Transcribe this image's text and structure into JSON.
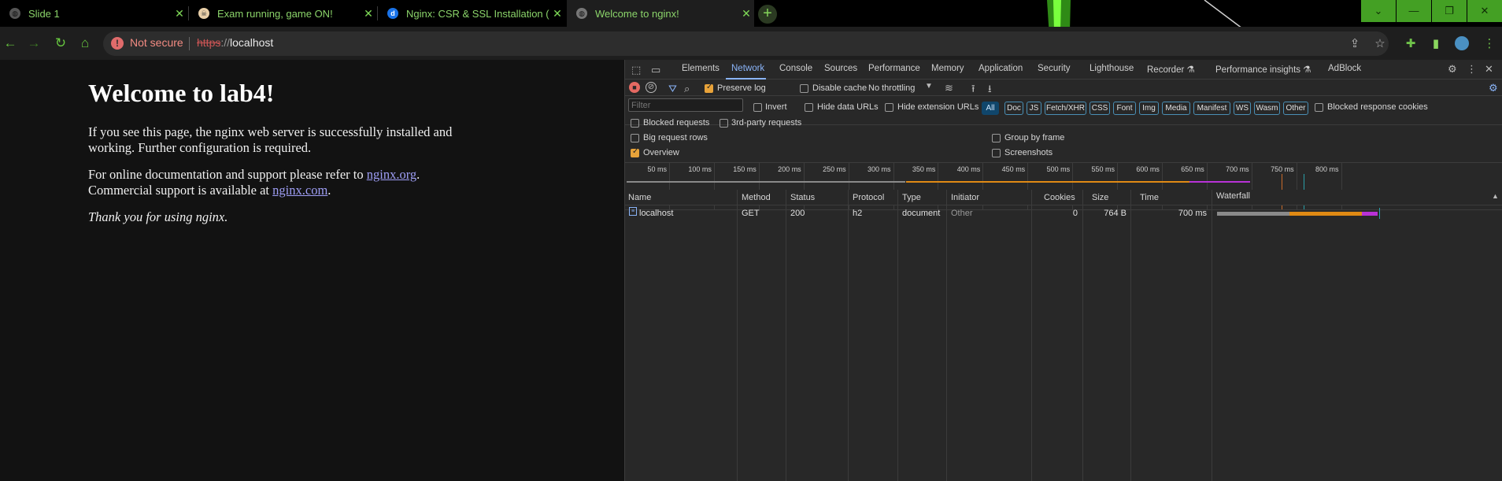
{
  "browser": {
    "tabs": [
      {
        "title": "Slide 1",
        "icon": "globe-icon",
        "active": false
      },
      {
        "title": "Exam running, game ON!",
        "icon": "skull-icon",
        "active": false
      },
      {
        "title": "Nginx: CSR & SSL Installation (O",
        "icon": "d-icon",
        "active": false
      },
      {
        "title": "Welcome to nginx!",
        "icon": "globe-icon",
        "active": true
      }
    ],
    "new_tab": "+",
    "security_label": "Not secure",
    "url_protocol": "https",
    "url_separator": "://",
    "url_host": "localhost"
  },
  "page": {
    "heading": "Welcome to lab4!",
    "para1": "If you see this page, the nginx web server is successfully installed and working. Further configuration is required.",
    "para2_prefix": "For online documentation and support please refer to ",
    "link1": "nginx.org",
    "para2_mid": ".",
    "para2_line2_prefix": "Commercial support is available at ",
    "link2": "nginx.com",
    "para2_suffix": ".",
    "thanks": "Thank you for using nginx."
  },
  "devtools": {
    "tabs": [
      "Elements",
      "Network",
      "Console",
      "Sources",
      "Performance",
      "Memory",
      "Application",
      "Security",
      "Lighthouse",
      "Recorder",
      "Performance insights",
      "AdBlock"
    ],
    "active_tab": "Network",
    "toolbar": {
      "preserve_log": "Preserve log",
      "disable_cache": "Disable cache",
      "throttling": "No throttling"
    },
    "filter": {
      "placeholder": "Filter",
      "invert": "Invert",
      "hide_data_urls": "Hide data URLs",
      "hide_extension_urls": "Hide extension URLs",
      "types": [
        "All",
        "Doc",
        "JS",
        "Fetch/XHR",
        "CSS",
        "Font",
        "Img",
        "Media",
        "Manifest",
        "WS",
        "Wasm",
        "Other"
      ],
      "blocked_response_cookies": "Blocked response cookies",
      "blocked_requests": "Blocked requests",
      "third_party_requests": "3rd-party requests"
    },
    "options": {
      "big_request_rows": "Big request rows",
      "group_by_frame": "Group by frame",
      "overview": "Overview",
      "screenshots": "Screenshots"
    },
    "timeline_ticks": [
      "50 ms",
      "100 ms",
      "150 ms",
      "200 ms",
      "250 ms",
      "300 ms",
      "350 ms",
      "400 ms",
      "450 ms",
      "500 ms",
      "550 ms",
      "600 ms",
      "650 ms",
      "700 ms",
      "750 ms",
      "800 ms"
    ],
    "columns": [
      "Name",
      "Method",
      "Status",
      "Protocol",
      "Type",
      "Initiator",
      "Cookies",
      "Size",
      "Time",
      "Waterfall"
    ],
    "rows": [
      {
        "name": "localhost",
        "method": "GET",
        "status": "200",
        "protocol": "h2",
        "type": "document",
        "initiator": "Other",
        "cookies": "0",
        "size": "764 B",
        "time": "700 ms"
      }
    ],
    "colors": {
      "accent": "#8ab4f8",
      "waiting": "#e08a14",
      "download": "#b832d6",
      "queue": "#8a8a8a"
    }
  }
}
